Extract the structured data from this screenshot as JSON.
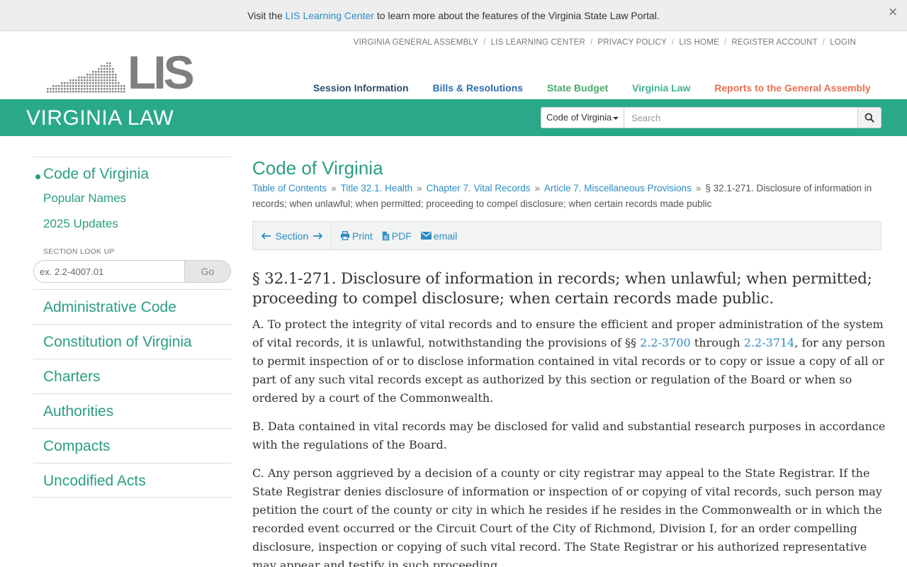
{
  "banner": {
    "prefix": "Visit the",
    "link": "LIS Learning Center",
    "suffix": "to learn more about the features of the Virginia State Law Portal.",
    "close_glyph": "×"
  },
  "utility_nav": [
    "VIRGINIA GENERAL ASSEMBLY",
    "LIS LEARNING CENTER",
    "PRIVACY POLICY",
    "LIS HOME",
    "REGISTER ACCOUNT",
    "LOGIN"
  ],
  "logo": {
    "text": "LIS"
  },
  "main_nav": {
    "session": "Session Information",
    "bills": "Bills & Resolutions",
    "budget": "State Budget",
    "law": "Virginia Law",
    "reports": "Reports to the General Assembly"
  },
  "header": {
    "title": "VIRGINIA LAW",
    "search_scope": "Code of Virginia",
    "search_placeholder": "Search",
    "search_icon": "search-icon"
  },
  "sidebar": {
    "active": "Code of Virginia",
    "sub": [
      "Popular Names",
      "2025 Updates"
    ],
    "lookup_label": "SECTION LOOK UP",
    "lookup_placeholder": "ex. 2.2-4007.01",
    "lookup_button": "Go",
    "items": [
      "Administrative Code",
      "Constitution of Virginia",
      "Charters",
      "Authorities",
      "Compacts",
      "Uncodified Acts"
    ]
  },
  "main": {
    "title": "Code of Virginia",
    "breadcrumb": {
      "links": [
        "Table of Contents",
        "Title 32.1. Health",
        "Chapter 7. Vital Records",
        "Article 7. Miscellaneous Provisions"
      ],
      "current": "§ 32.1-271. Disclosure of information in records; when unlawful; when permitted; proceeding to compel disclosure; when certain records made public",
      "separator": "»"
    },
    "toolbar": {
      "section": "Section",
      "print": "Print",
      "pdf": "PDF",
      "email": "email"
    },
    "section_title": "§ 32.1-271. Disclosure of information in records; when unlawful; when permitted; proceeding to compel disclosure; when certain records made public.",
    "para_a": {
      "before": "A. To protect the integrity of vital records and to ensure the efficient and proper administration of the system of vital records, it is unlawful, notwithstanding the provisions of §§",
      "link1": "2.2-3700",
      "between": "through",
      "link2": "2.2-3714",
      "after": ", for any person to permit inspection of or to disclose information contained in vital records or to copy or issue a copy of all or part of any such vital records except as authorized by this section or regulation of the Board or when so ordered by a court of the Commonwealth."
    },
    "para_b": "B. Data contained in vital records may be disclosed for valid and substantial research purposes in accordance with the regulations of the Board.",
    "para_c": "C. Any person aggrieved by a decision of a county or city registrar may appeal to the State Registrar. If the State Registrar denies disclosure of information or inspection of or copying of vital records, such person may petition the court of the county or city in which he resides if he resides in the Commonwealth or in which the recorded event occurred or the Circuit Court of the City of Richmond, Division I, for an order compelling disclosure, inspection or copying of such vital record. The State Registrar or his authorized representative may appear and testify in such proceeding."
  },
  "colors": {
    "brand_green": "#2aa98a",
    "link_blue": "#2b8cc4",
    "reports_orange": "#e8704f"
  }
}
